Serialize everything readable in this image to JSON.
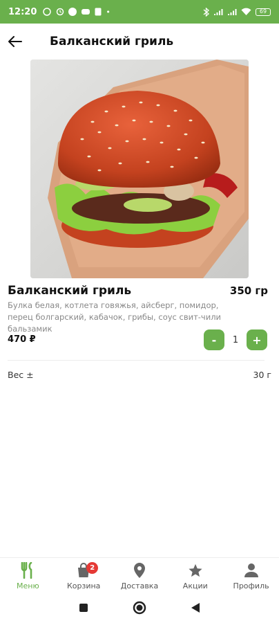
{
  "status_bar": {
    "time": "12:20",
    "battery": "69"
  },
  "header": {
    "title": "Балканский гриль"
  },
  "product": {
    "name": "Балканский гриль",
    "weight": "350 гр",
    "description": "Булка белая, котлета говяжья, айсберг, помидор, перец болгарский, кабачок, грибы, соус свит-чили бальзамик",
    "price": "470 ₽",
    "quantity": "1",
    "minus_label": "-",
    "plus_label": "+"
  },
  "specs": [
    {
      "label": "Вес ±",
      "value": "30 г"
    }
  ],
  "bottom_nav": {
    "items": [
      {
        "label": "Меню",
        "icon": "fork-knife-icon",
        "active": true
      },
      {
        "label": "Корзина",
        "icon": "bag-icon",
        "badge": "2"
      },
      {
        "label": "Доставка",
        "icon": "location-pin-icon"
      },
      {
        "label": "Акции",
        "icon": "star-icon"
      },
      {
        "label": "Профиль",
        "icon": "person-icon"
      }
    ]
  },
  "colors": {
    "accent": "#6ab04c",
    "badge": "#e53935"
  }
}
